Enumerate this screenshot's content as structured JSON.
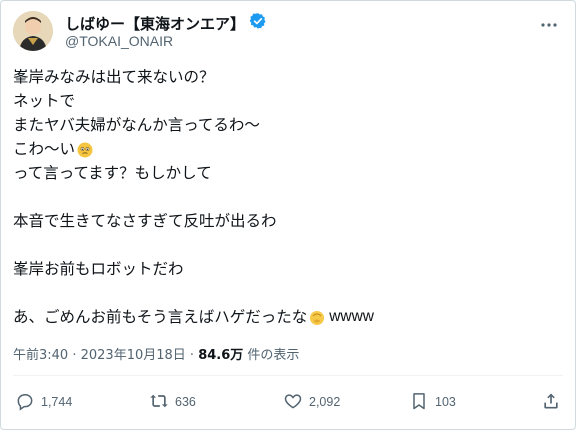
{
  "author": {
    "display_name": "しばゆー【東海オンエア】",
    "handle": "@TOKAI_ONAIR",
    "verified_badge_icon": "verified-badge-icon",
    "more_icon": "more-options-icon"
  },
  "post": {
    "lines": [
      "峯岸みなみは出て来ないの？",
      "ネットで",
      "またヤバ夫婦がなんか言ってるわ〜",
      "こわ〜い",
      "って言ってます？もしかして",
      "",
      "本音で生きてなさすぎて反吐が出るわ",
      "",
      "峯岸お前もロボットだわ",
      "",
      "あ、ごめんお前もそう言えばハゲだったな",
      "wwww"
    ]
  },
  "meta": {
    "time": "午前3:40",
    "separator": " · ",
    "date": "2023年10月18日",
    "views": "84.6万",
    "views_suffix": " 件の表示"
  },
  "actions": {
    "replies": "1,744",
    "reposts": "636",
    "likes": "2,092",
    "bookmarks": "103"
  },
  "colors": {
    "verified": "#1d9bf0",
    "icon_gray": "#536471"
  }
}
